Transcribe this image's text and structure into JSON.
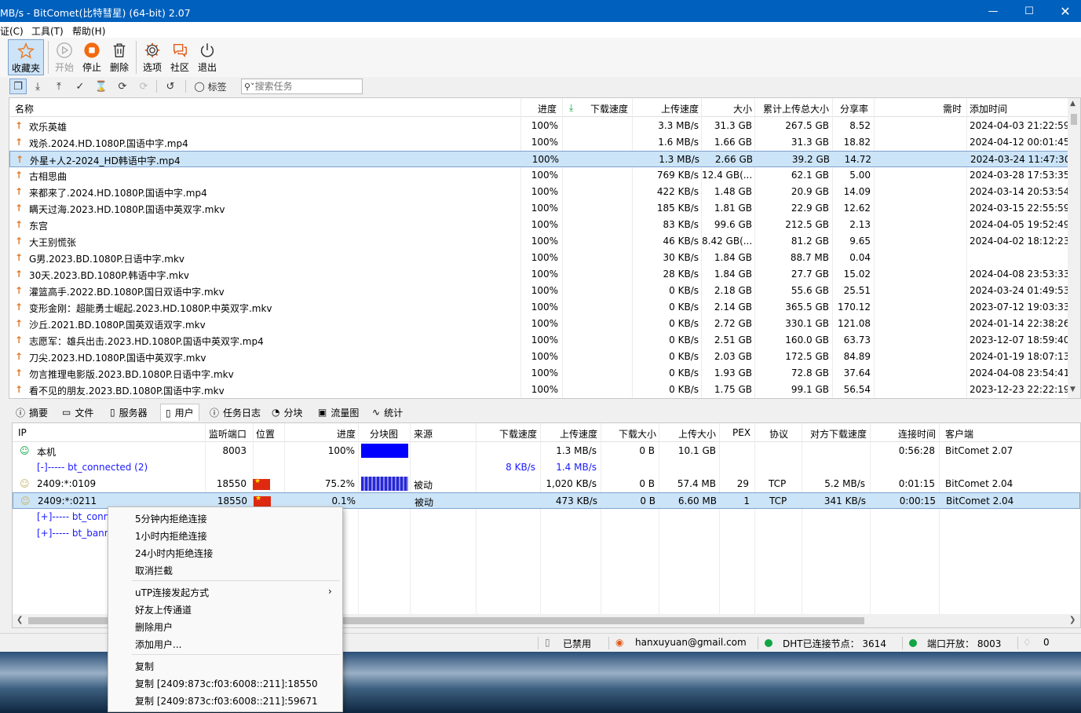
{
  "window": {
    "title": "MB/s - BitComet(比特彗星) (64-bit) 2.07"
  },
  "menu": [
    "证(C)",
    "工具(T)",
    "帮助(H)"
  ],
  "toolbar": [
    {
      "label": "收藏夹",
      "icon": "star-icon"
    },
    {
      "label": "开始",
      "icon": "play-icon"
    },
    {
      "label": "停止",
      "icon": "stop-icon"
    },
    {
      "label": "删除",
      "icon": "trash-icon"
    },
    {
      "label": "选项",
      "icon": "gear-icon"
    },
    {
      "label": "社区",
      "icon": "chat-icon"
    },
    {
      "label": "退出",
      "icon": "power-icon"
    }
  ],
  "toolbar2": {
    "tag_label": "标签",
    "search_placeholder": "搜索任务"
  },
  "torrent_table": {
    "headers": {
      "name": "名称",
      "progress": "进度",
      "down_speed": "下载速度",
      "up_speed": "上传速度",
      "size": "大小",
      "total_up": "累计上传总大小",
      "ratio": "分享率",
      "time_needed": "需时",
      "added": "添加时间"
    },
    "rows": [
      {
        "name": "欢乐英雄",
        "progress": "100%",
        "up_speed": "3.3 MB/s",
        "size": "31.3 GB",
        "total_up": "267.5 GB",
        "ratio": "8.52",
        "added": "2024-04-03 21:22:59"
      },
      {
        "name": "戏杀.2024.HD.1080P.国语中字.mp4",
        "progress": "100%",
        "up_speed": "1.6 MB/s",
        "size": "1.66 GB",
        "total_up": "31.3 GB",
        "ratio": "18.82",
        "added": "2024-04-12 00:01:45"
      },
      {
        "name": "外星+人2-2024_HD韩语中字.mp4",
        "progress": "100%",
        "up_speed": "1.3 MB/s",
        "size": "2.66 GB",
        "total_up": "39.2 GB",
        "ratio": "14.72",
        "added": "2024-03-24 11:47:30"
      },
      {
        "name": "古相思曲",
        "progress": "100%",
        "up_speed": "769 KB/s",
        "size": "12.4 GB(...",
        "total_up": "62.1 GB",
        "ratio": "5.00",
        "added": "2024-03-28 17:53:35"
      },
      {
        "name": "来都来了.2024.HD.1080P.国语中字.mp4",
        "progress": "100%",
        "up_speed": "422 KB/s",
        "size": "1.48 GB",
        "total_up": "20.9 GB",
        "ratio": "14.09",
        "added": "2024-03-14 20:53:54"
      },
      {
        "name": "瞒天过海.2023.HD.1080P.国语中英双字.mkv",
        "progress": "100%",
        "up_speed": "185 KB/s",
        "size": "1.81 GB",
        "total_up": "22.9 GB",
        "ratio": "12.62",
        "added": "2024-03-15 22:55:59"
      },
      {
        "name": "东宫",
        "progress": "100%",
        "up_speed": "83 KB/s",
        "size": "99.6 GB",
        "total_up": "212.5 GB",
        "ratio": "2.13",
        "added": "2024-04-05 19:52:49"
      },
      {
        "name": "大王别慌张",
        "progress": "100%",
        "up_speed": "46 KB/s",
        "size": "8.42 GB(...",
        "total_up": "81.2 GB",
        "ratio": "9.65",
        "added": "2024-04-02 18:12:23"
      },
      {
        "name": "G男.2023.BD.1080P.日语中字.mkv",
        "progress": "100%",
        "up_speed": "30 KB/s",
        "size": "1.84 GB",
        "total_up": "88.7 MB",
        "ratio": "0.04",
        "added": ""
      },
      {
        "name": "30天.2023.BD.1080P.韩语中字.mkv",
        "progress": "100%",
        "up_speed": "28 KB/s",
        "size": "1.84 GB",
        "total_up": "27.7 GB",
        "ratio": "15.02",
        "added": "2024-04-08 23:53:33"
      },
      {
        "name": "灌篮高手.2022.BD.1080P.国日双语中字.mkv",
        "progress": "100%",
        "up_speed": "0 KB/s",
        "size": "2.18 GB",
        "total_up": "55.6 GB",
        "ratio": "25.51",
        "added": "2024-03-24 01:49:53"
      },
      {
        "name": "变形金刚：超能勇士崛起.2023.HD.1080P.中英双字.mkv",
        "progress": "100%",
        "up_speed": "0 KB/s",
        "size": "2.14 GB",
        "total_up": "365.5 GB",
        "ratio": "170.12",
        "added": "2023-07-12 19:03:33"
      },
      {
        "name": "沙丘.2021.BD.1080P.国英双语双字.mkv",
        "progress": "100%",
        "up_speed": "0 KB/s",
        "size": "2.72 GB",
        "total_up": "330.1 GB",
        "ratio": "121.08",
        "added": "2024-01-14 22:38:26"
      },
      {
        "name": "志愿军：雄兵出击.2023.HD.1080P.国语中英双字.mp4",
        "progress": "100%",
        "up_speed": "0 KB/s",
        "size": "2.51 GB",
        "total_up": "160.0 GB",
        "ratio": "63.73",
        "added": "2023-12-07 18:59:40"
      },
      {
        "name": "刀尖.2023.HD.1080P.国语中英双字.mkv",
        "progress": "100%",
        "up_speed": "0 KB/s",
        "size": "2.03 GB",
        "total_up": "172.5 GB",
        "ratio": "84.89",
        "added": "2024-01-19 18:07:13"
      },
      {
        "name": "勿言推理电影版.2023.BD.1080P.日语中字.mkv",
        "progress": "100%",
        "up_speed": "0 KB/s",
        "size": "1.93 GB",
        "total_up": "72.8 GB",
        "ratio": "37.64",
        "added": "2024-04-08 23:54:41"
      },
      {
        "name": "看不见的朋友.2023.BD.1080P.国语中字.mkv",
        "progress": "100%",
        "up_speed": "0 KB/s",
        "size": "1.75 GB",
        "total_up": "99.1 GB",
        "ratio": "56.54",
        "added": "2023-12-23 22:22:19"
      }
    ]
  },
  "tabs": [
    {
      "label": "摘要",
      "icon": "info-icon"
    },
    {
      "label": "文件",
      "icon": "folder-icon"
    },
    {
      "label": "服务器",
      "icon": "server-icon"
    },
    {
      "label": "用户",
      "icon": "user-icon"
    },
    {
      "label": "任务日志",
      "icon": "log-icon"
    },
    {
      "label": "分块",
      "icon": "pie-icon"
    },
    {
      "label": "流量图",
      "icon": "chart-icon"
    },
    {
      "label": "统计",
      "icon": "stats-icon"
    }
  ],
  "peer_table": {
    "headers": {
      "ip": "IP",
      "port": "监听端口",
      "location": "位置",
      "progress": "进度",
      "pieces": "分块图",
      "source": "来源",
      "down_speed": "下载速度",
      "up_speed": "上传速度",
      "down_size": "下载大小",
      "up_size": "上传大小",
      "pex": "PEX",
      "protocol": "协议",
      "remote_down": "对方下载速度",
      "conn_time": "连接时间",
      "client": "客户端"
    },
    "rows": [
      {
        "ip": "本机",
        "port": "8003",
        "progress": "100%",
        "source": "",
        "down_speed": "",
        "up_speed": "1.3 MB/s",
        "down_size": "0 B",
        "up_size": "10.1 GB",
        "pex": "",
        "protocol": "",
        "remote_down": "",
        "conn_time": "0:56:28",
        "client": "BitComet 2.07"
      },
      {
        "ip": "[-]----- bt_connected (2)",
        "port": "",
        "progress": "",
        "source": "",
        "down_speed": "8 KB/s",
        "up_speed": "1.4 MB/s",
        "down_size": "",
        "up_size": "",
        "pex": "",
        "protocol": "",
        "remote_down": "",
        "conn_time": "",
        "client": ""
      },
      {
        "ip": "2409:*:0109",
        "port": "18550",
        "progress": "75.2%",
        "source": "被动",
        "down_speed": "",
        "up_speed": "1,020 KB/s",
        "down_size": "0 B",
        "up_size": "57.4 MB",
        "pex": "29",
        "protocol": "TCP",
        "remote_down": "5.2 MB/s",
        "conn_time": "0:01:15",
        "client": "BitComet 2.04"
      },
      {
        "ip": "2409:*:0211",
        "port": "18550",
        "progress": "0.1%",
        "source": "被动",
        "down_speed": "",
        "up_speed": "473 KB/s",
        "down_size": "0 B",
        "up_size": "6.60 MB",
        "pex": "1",
        "protocol": "TCP",
        "remote_down": "341 KB/s",
        "conn_time": "0:00:15",
        "client": "BitComet 2.04"
      },
      {
        "ip": "[+]----- bt_conn",
        "port": "",
        "progress": "",
        "source": "",
        "down_speed": "",
        "up_speed": "",
        "down_size": "",
        "up_size": "",
        "pex": "",
        "protocol": "",
        "remote_down": "",
        "conn_time": "",
        "client": ""
      },
      {
        "ip": "[+]----- bt_bann",
        "port": "",
        "progress": "",
        "source": "",
        "down_speed": "",
        "up_speed": "",
        "down_size": "",
        "up_size": "",
        "pex": "",
        "protocol": "",
        "remote_down": "",
        "conn_time": "",
        "client": ""
      }
    ]
  },
  "context_menu": [
    {
      "label": "5分钟内拒绝连接"
    },
    {
      "label": "1小时内拒绝连接"
    },
    {
      "label": "24小时内拒绝连接"
    },
    {
      "label": "取消拦截"
    },
    {
      "label": "uTP连接发起方式",
      "submenu": true
    },
    {
      "label": "好友上传通道"
    },
    {
      "label": "删除用户"
    },
    {
      "label": "添加用户..."
    },
    {
      "label": "复制"
    },
    {
      "label": "复制 [2409:873c:f03:6008::211]:18550"
    },
    {
      "label": "复制 [2409:873c:f03:6008::211]:59671"
    }
  ],
  "statusbar": {
    "disabled": "已禁用",
    "email": "hanxuyuan@gmail.com",
    "dht": "DHT已连接节点：  3614",
    "port": "端口开放：  8003",
    "notify_count": "0"
  }
}
